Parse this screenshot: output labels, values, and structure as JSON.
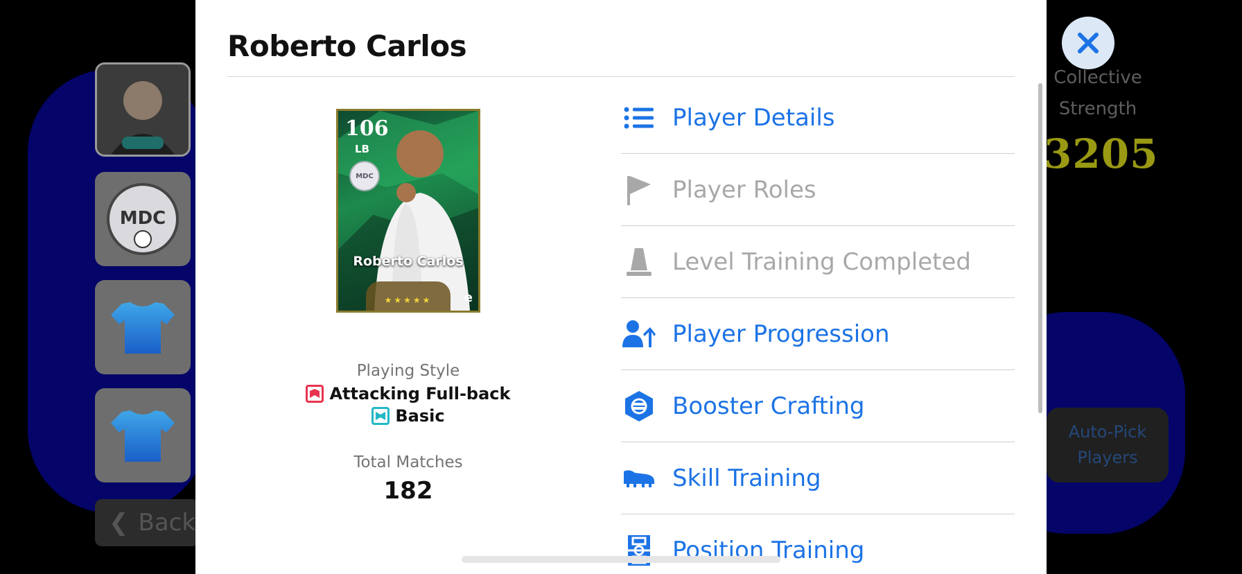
{
  "modal": {
    "title": "Roberto Carlos",
    "close_icon": "close-icon"
  },
  "player_card": {
    "rating": "106",
    "position": "LB",
    "club_badge": "MDC",
    "name": "Roberto Carlos",
    "stars": "★★★★★",
    "logo": "e"
  },
  "info": {
    "playing_style_label": "Playing Style",
    "playing_style": "Attacking Full-back",
    "playing_style_color": "#e8334f",
    "ai_style": "Basic",
    "ai_style_color": "#22b8c6",
    "total_matches_label": "Total Matches",
    "total_matches": "182"
  },
  "menu": {
    "items": [
      {
        "label": "Player Details",
        "icon": "list-icon",
        "enabled": true
      },
      {
        "label": "Player Roles",
        "icon": "flag-icon",
        "enabled": false
      },
      {
        "label": "Level Training Completed",
        "icon": "cone-icon",
        "enabled": false
      },
      {
        "label": "Player Progression",
        "icon": "user-up-icon",
        "enabled": true
      },
      {
        "label": "Booster Crafting",
        "icon": "booster-icon",
        "enabled": true
      },
      {
        "label": "Skill Training",
        "icon": "boot-icon",
        "enabled": true
      },
      {
        "label": "Position Training",
        "icon": "pitch-icon",
        "enabled": true
      }
    ]
  },
  "background": {
    "strength_label_1": "Collective",
    "strength_label_2": "Strength",
    "strength_value": "3205",
    "auto_pick_1": "Auto-Pick",
    "auto_pick_2": "Players",
    "back_label": "Back",
    "club_badge_text": "MDC"
  },
  "colors": {
    "accent": "#1c73e5",
    "disabled": "#a8a8a8",
    "strength": "#999914"
  }
}
